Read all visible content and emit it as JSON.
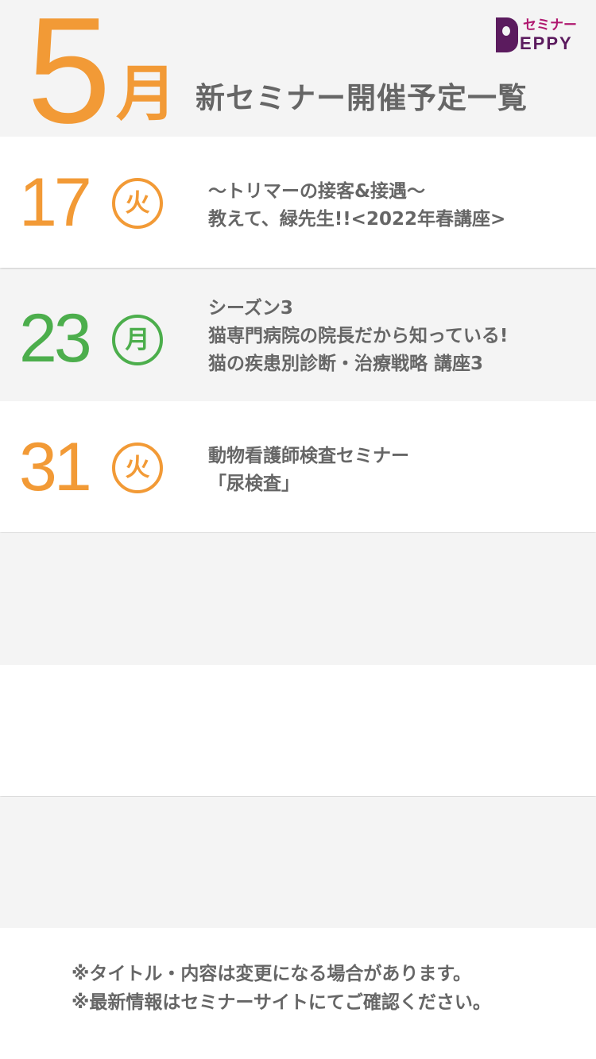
{
  "header": {
    "month_number": "5",
    "month_kanji": "月",
    "title": "新セミナー開催予定一覧",
    "logo": {
      "sub_text": "セミナー",
      "main_text": "EPPY",
      "brand_color": "#5b1b5e",
      "accent_color": "#b0186f"
    }
  },
  "events": [
    {
      "day": "17",
      "weekday": "火",
      "color": "#f29a36",
      "lines": [
        "〜トリマーの接客&接遇〜",
        "教えて、緑先生!!<2022年春講座>"
      ]
    },
    {
      "day": "23",
      "weekday": "月",
      "color": "#4cae4c",
      "lines": [
        "シーズン3",
        "猫専門病院の院長だから知っている!",
        "猫の疾患別診断・治療戦略 講座3"
      ]
    },
    {
      "day": "31",
      "weekday": "火",
      "color": "#f29a36",
      "lines": [
        "動物看護師検査セミナー",
        "「尿検査」"
      ]
    }
  ],
  "footer": {
    "notes": [
      "※タイトル・内容は変更になる場合があります。",
      "※最新情報はセミナーサイトにてご確認ください。"
    ]
  },
  "colors": {
    "accent_orange": "#f29a36",
    "accent_green": "#4cae4c",
    "text_gray": "#666666",
    "row_gray": "#f4f4f4"
  }
}
